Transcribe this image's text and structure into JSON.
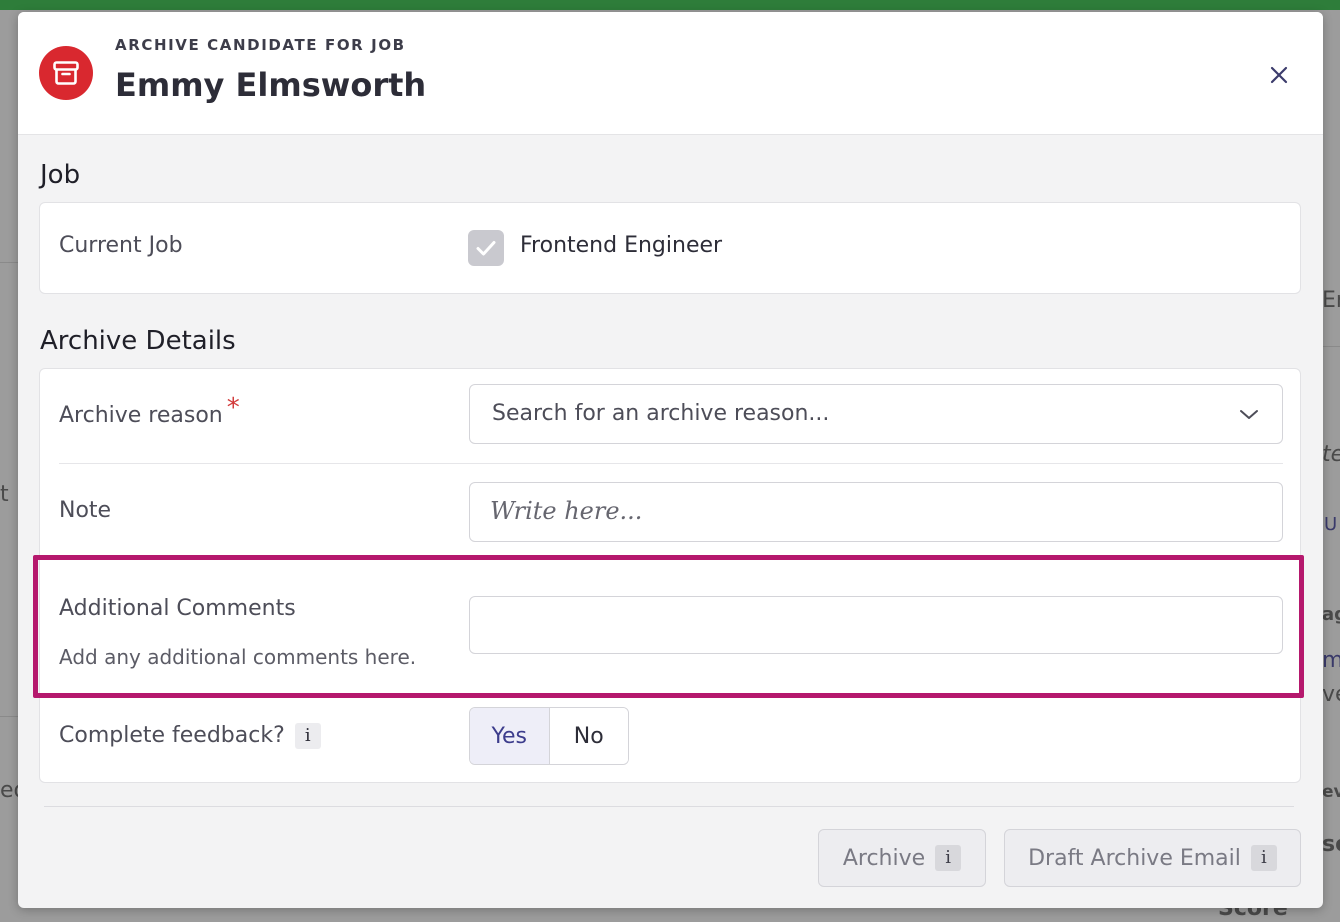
{
  "background": {
    "fragments": [
      "t",
      "ed",
      "En",
      "te",
      "U",
      "ag",
      "m",
      "ve",
      "ev",
      "so",
      "Score"
    ]
  },
  "modal": {
    "eyebrow": "ARCHIVE CANDIDATE FOR JOB",
    "title": "Emmy Elmsworth",
    "header_icon": "archive-icon",
    "close_icon": "close-icon",
    "accent_color": "#d9282f"
  },
  "job_section": {
    "title": "Job",
    "current_job_label": "Current Job",
    "current_job_value": "Frontend Engineer",
    "checked": true
  },
  "archive_section": {
    "title": "Archive Details",
    "reason_label": "Archive reason",
    "required_mark": "*",
    "reason_placeholder": "Search for an archive reason...",
    "note_label": "Note",
    "note_placeholder": "Write here...",
    "additional_label": "Additional Comments",
    "additional_help": "Add any additional comments here.",
    "additional_value": "",
    "feedback_label": "Complete feedback?",
    "feedback_info": "i",
    "feedback_options": [
      "Yes",
      "No"
    ],
    "feedback_selected": "Yes"
  },
  "footer": {
    "archive_label": "Archive",
    "archive_info": "i",
    "draft_label": "Draft Archive Email",
    "draft_info": "i"
  },
  "highlight_color": "#b5186d"
}
